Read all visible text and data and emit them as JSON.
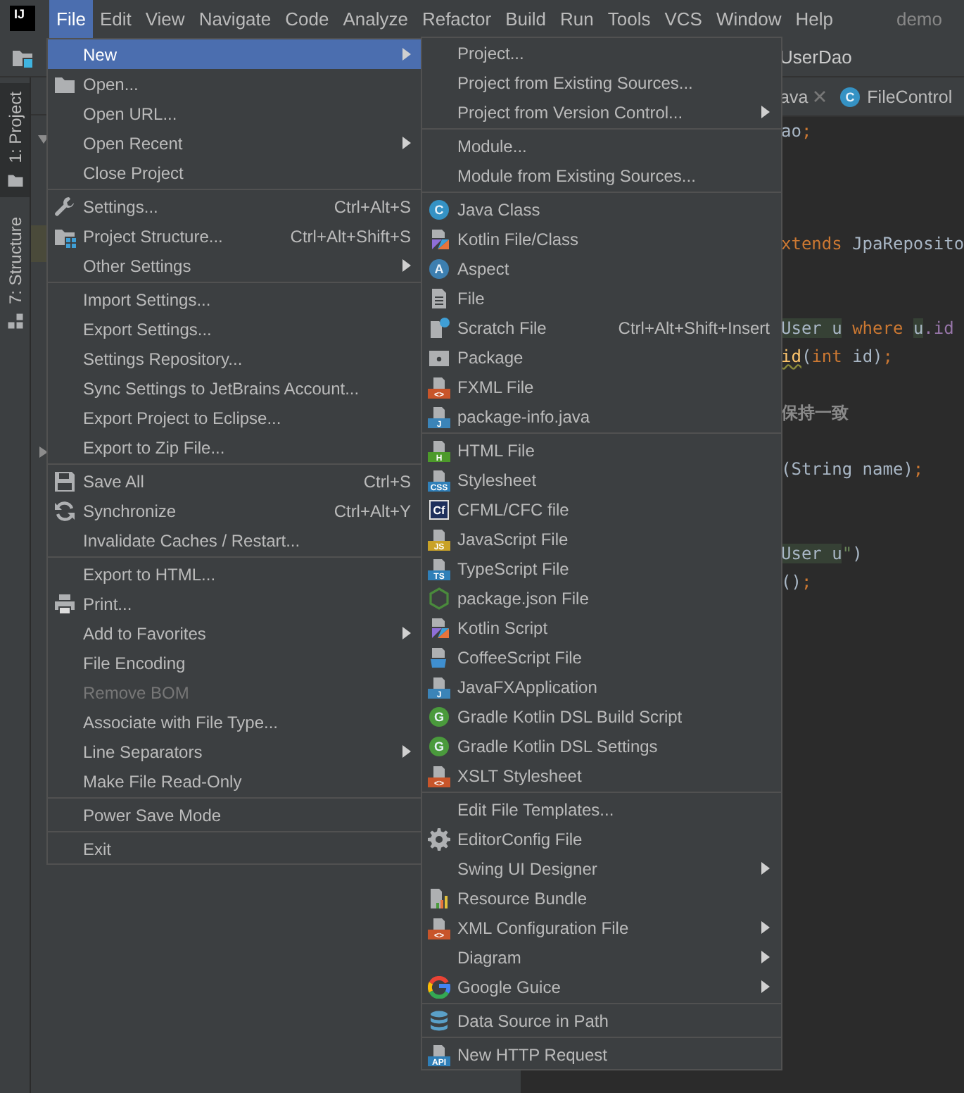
{
  "menu_bar": {
    "logo_text": "IJ",
    "items": [
      {
        "label": "File",
        "selected": true
      },
      {
        "label": "Edit",
        "selected": false
      },
      {
        "label": "View",
        "selected": false
      },
      {
        "label": "Navigate",
        "selected": false
      },
      {
        "label": "Code",
        "selected": false
      },
      {
        "label": "Analyze",
        "selected": false
      },
      {
        "label": "Refactor",
        "selected": false
      },
      {
        "label": "Build",
        "selected": false
      },
      {
        "label": "Run",
        "selected": false
      },
      {
        "label": "Tools",
        "selected": false
      },
      {
        "label": "VCS",
        "selected": false
      },
      {
        "label": "Window",
        "selected": false
      },
      {
        "label": "Help",
        "selected": false
      }
    ],
    "project_title": "demo"
  },
  "navigation_bar": {
    "file": "UserDao"
  },
  "tool_window_strip": [
    {
      "label": "1: Project",
      "selected": true
    },
    {
      "label": "7: Structure",
      "selected": false
    }
  ],
  "editor": {
    "tabs": [
      {
        "label": "ava",
        "closable": true
      },
      {
        "label": "FileControl",
        "closable": false,
        "icon": {
          "kind": "circle",
          "text": "C",
          "color": "#3592c4"
        }
      }
    ],
    "lines": [
      {
        "kind": "code",
        "tokens": [
          {
            "text": "ao",
            "kind": "plain"
          },
          {
            "text": ";",
            "kind": "keyword"
          }
        ]
      },
      {
        "kind": "blank"
      },
      {
        "kind": "blank"
      },
      {
        "kind": "blank"
      },
      {
        "kind": "code",
        "tokens": [
          {
            "text": "xtends",
            "kind": "keyword"
          },
          {
            "text": " JpaReposito",
            "kind": "plain"
          }
        ]
      },
      {
        "kind": "blank"
      },
      {
        "kind": "blank"
      },
      {
        "kind": "code",
        "tokens": [
          {
            "text": "User",
            "kind": "sql"
          },
          {
            "text": " u",
            "kind": "sql"
          },
          {
            "text": " where ",
            "kind": "keyword"
          },
          {
            "text": "u",
            "kind": "sql"
          },
          {
            "text": ".id",
            "kind": "field"
          }
        ]
      },
      {
        "kind": "code",
        "tokens": [
          {
            "text": "id",
            "kind": "method"
          },
          {
            "text": "(",
            "kind": "plain"
          },
          {
            "text": "int",
            "kind": "keyword"
          },
          {
            "text": " id)",
            "kind": "plain"
          },
          {
            "text": ";",
            "kind": "keyword"
          }
        ]
      },
      {
        "kind": "blank"
      },
      {
        "kind": "code",
        "tokens": [
          {
            "text": "保持一致",
            "kind": "comment"
          }
        ]
      },
      {
        "kind": "blank"
      },
      {
        "kind": "code",
        "tokens": [
          {
            "text": "(String name)",
            "kind": "plain"
          },
          {
            "text": ";",
            "kind": "keyword"
          }
        ]
      },
      {
        "kind": "blank"
      },
      {
        "kind": "blank"
      },
      {
        "kind": "code",
        "tokens": [
          {
            "text": "User u",
            "kind": "sql"
          },
          {
            "text": "\"",
            "kind": "string"
          },
          {
            "text": ")",
            "kind": "plain"
          }
        ]
      },
      {
        "kind": "code",
        "tokens": [
          {
            "text": "()",
            "kind": "plain"
          },
          {
            "text": ";",
            "kind": "keyword"
          }
        ]
      }
    ]
  },
  "file_menu": {
    "sections": [
      {
        "items": [
          {
            "label": "New",
            "submenu": true,
            "selected": true,
            "disabled": false
          },
          {
            "label": "Open...",
            "submenu": false,
            "selected": false,
            "disabled": false,
            "icon": {
              "kind": "folder"
            }
          },
          {
            "label": "Open URL...",
            "submenu": false,
            "selected": false,
            "disabled": false
          },
          {
            "label": "Open Recent",
            "submenu": true,
            "selected": false,
            "disabled": false
          },
          {
            "label": "Close Project",
            "submenu": false,
            "selected": false,
            "disabled": false
          }
        ]
      },
      {
        "items": [
          {
            "label": "Settings...",
            "shortcut": "Ctrl+Alt+S",
            "submenu": false,
            "selected": false,
            "disabled": false,
            "icon": {
              "kind": "wrench"
            }
          },
          {
            "label": "Project Structure...",
            "shortcut": "Ctrl+Alt+Shift+S",
            "submenu": false,
            "selected": false,
            "disabled": false,
            "icon": {
              "kind": "structure"
            }
          },
          {
            "label": "Other Settings",
            "submenu": true,
            "selected": false,
            "disabled": false
          }
        ]
      },
      {
        "items": [
          {
            "label": "Import Settings...",
            "submenu": false,
            "selected": false,
            "disabled": false
          },
          {
            "label": "Export Settings...",
            "submenu": false,
            "selected": false,
            "disabled": false
          },
          {
            "label": "Settings Repository...",
            "submenu": false,
            "selected": false,
            "disabled": false
          },
          {
            "label": "Sync Settings to JetBrains Account...",
            "submenu": false,
            "selected": false,
            "disabled": false
          },
          {
            "label": "Export Project to Eclipse...",
            "submenu": false,
            "selected": false,
            "disabled": false
          },
          {
            "label": "Export to Zip File...",
            "submenu": false,
            "selected": false,
            "disabled": false
          }
        ]
      },
      {
        "items": [
          {
            "label": "Save All",
            "shortcut": "Ctrl+S",
            "submenu": false,
            "selected": false,
            "disabled": false,
            "icon": {
              "kind": "save"
            }
          },
          {
            "label": "Synchronize",
            "shortcut": "Ctrl+Alt+Y",
            "submenu": false,
            "selected": false,
            "disabled": false,
            "icon": {
              "kind": "sync"
            }
          },
          {
            "label": "Invalidate Caches / Restart...",
            "submenu": false,
            "selected": false,
            "disabled": false
          }
        ]
      },
      {
        "items": [
          {
            "label": "Export to HTML...",
            "submenu": false,
            "selected": false,
            "disabled": false
          },
          {
            "label": "Print...",
            "submenu": false,
            "selected": false,
            "disabled": false,
            "icon": {
              "kind": "print"
            }
          },
          {
            "label": "Add to Favorites",
            "submenu": true,
            "selected": false,
            "disabled": false
          },
          {
            "label": "File Encoding",
            "submenu": false,
            "selected": false,
            "disabled": false
          },
          {
            "label": "Remove BOM",
            "submenu": false,
            "selected": false,
            "disabled": true
          },
          {
            "label": "Associate with File Type...",
            "submenu": false,
            "selected": false,
            "disabled": false
          },
          {
            "label": "Line Separators",
            "submenu": true,
            "selected": false,
            "disabled": false
          },
          {
            "label": "Make File Read-Only",
            "submenu": false,
            "selected": false,
            "disabled": false
          }
        ]
      },
      {
        "items": [
          {
            "label": "Power Save Mode",
            "submenu": false,
            "selected": false,
            "disabled": false
          }
        ]
      },
      {
        "items": [
          {
            "label": "Exit",
            "submenu": false,
            "selected": false,
            "disabled": false
          }
        ]
      }
    ]
  },
  "new_submenu": {
    "sections": [
      {
        "items": [
          {
            "label": "Project...",
            "submenu": false
          },
          {
            "label": "Project from Existing Sources...",
            "submenu": false
          },
          {
            "label": "Project from Version Control...",
            "submenu": true
          }
        ]
      },
      {
        "items": [
          {
            "label": "Module...",
            "submenu": false
          },
          {
            "label": "Module from Existing Sources...",
            "submenu": false
          }
        ]
      },
      {
        "items": [
          {
            "label": "Java Class",
            "submenu": false,
            "icon": {
              "kind": "circle",
              "text": "C",
              "color": "#3592c4"
            }
          },
          {
            "label": "Kotlin File/Class",
            "submenu": false,
            "icon": {
              "kind": "kotlin"
            }
          },
          {
            "label": "Aspect",
            "submenu": false,
            "icon": {
              "kind": "circle",
              "text": "A",
              "color": "#3d7fb0"
            }
          },
          {
            "label": "File",
            "submenu": false,
            "icon": {
              "kind": "file"
            }
          },
          {
            "label": "Scratch File",
            "shortcut": "Ctrl+Alt+Shift+Insert",
            "submenu": false,
            "icon": {
              "kind": "scratch"
            }
          },
          {
            "label": "Package",
            "submenu": false,
            "icon": {
              "kind": "package"
            }
          },
          {
            "label": "FXML File",
            "submenu": false,
            "icon": {
              "kind": "file-tag",
              "text": "<>",
              "color": "#c8552a"
            }
          },
          {
            "label": "package-info.java",
            "submenu": false,
            "icon": {
              "kind": "file-tag",
              "text": "J",
              "color": "#3b84b8"
            }
          }
        ]
      },
      {
        "items": [
          {
            "label": "HTML File",
            "submenu": false,
            "icon": {
              "kind": "file-tag",
              "text": "H",
              "color": "#4c9a2a"
            }
          },
          {
            "label": "Stylesheet",
            "submenu": false,
            "icon": {
              "kind": "file-tag",
              "text": "CSS",
              "color": "#2f7fb8"
            }
          },
          {
            "label": "CFML/CFC file",
            "submenu": false,
            "icon": {
              "kind": "box",
              "text": "Cf",
              "color": "#1d2f5c"
            }
          },
          {
            "label": "JavaScript File",
            "submenu": false,
            "icon": {
              "kind": "file-tag",
              "text": "JS",
              "color": "#c9a227"
            }
          },
          {
            "label": "TypeScript File",
            "submenu": false,
            "icon": {
              "kind": "file-tag",
              "text": "TS",
              "color": "#2f7fb8"
            }
          },
          {
            "label": "package.json File",
            "submenu": false,
            "icon": {
              "kind": "hexagon",
              "color": "#4a8a3c"
            }
          },
          {
            "label": "Kotlin Script",
            "submenu": false,
            "icon": {
              "kind": "kotlin"
            }
          },
          {
            "label": "CoffeeScript File",
            "submenu": false,
            "icon": {
              "kind": "coffee"
            }
          },
          {
            "label": "JavaFXApplication",
            "submenu": false,
            "icon": {
              "kind": "file-tag",
              "text": "J",
              "color": "#3b84b8"
            }
          },
          {
            "label": "Gradle Kotlin DSL Build Script",
            "submenu": false,
            "icon": {
              "kind": "circle",
              "text": "G",
              "color": "#4a9a3c"
            }
          },
          {
            "label": "Gradle Kotlin DSL Settings",
            "submenu": false,
            "icon": {
              "kind": "circle",
              "text": "G",
              "color": "#4a9a3c"
            }
          },
          {
            "label": "XSLT Stylesheet",
            "submenu": false,
            "icon": {
              "kind": "file-tag",
              "text": "<>",
              "color": "#c8552a"
            }
          }
        ]
      },
      {
        "items": [
          {
            "label": "Edit File Templates...",
            "submenu": false
          },
          {
            "label": "EditorConfig File",
            "submenu": false,
            "icon": {
              "kind": "gear"
            }
          },
          {
            "label": "Swing UI Designer",
            "submenu": true
          },
          {
            "label": "Resource Bundle",
            "submenu": false,
            "icon": {
              "kind": "bundle"
            }
          },
          {
            "label": "XML Configuration File",
            "submenu": true,
            "icon": {
              "kind": "file-tag",
              "text": "<>",
              "color": "#c8552a"
            }
          },
          {
            "label": "Diagram",
            "submenu": true
          },
          {
            "label": "Google Guice",
            "submenu": true,
            "icon": {
              "kind": "google"
            }
          }
        ]
      },
      {
        "items": [
          {
            "label": "Data Source in Path",
            "submenu": false,
            "icon": {
              "kind": "database"
            }
          }
        ]
      },
      {
        "items": [
          {
            "label": "New HTTP Request",
            "submenu": false,
            "icon": {
              "kind": "file-tag",
              "text": "API",
              "color": "#2f7fb8"
            }
          }
        ]
      }
    ]
  }
}
